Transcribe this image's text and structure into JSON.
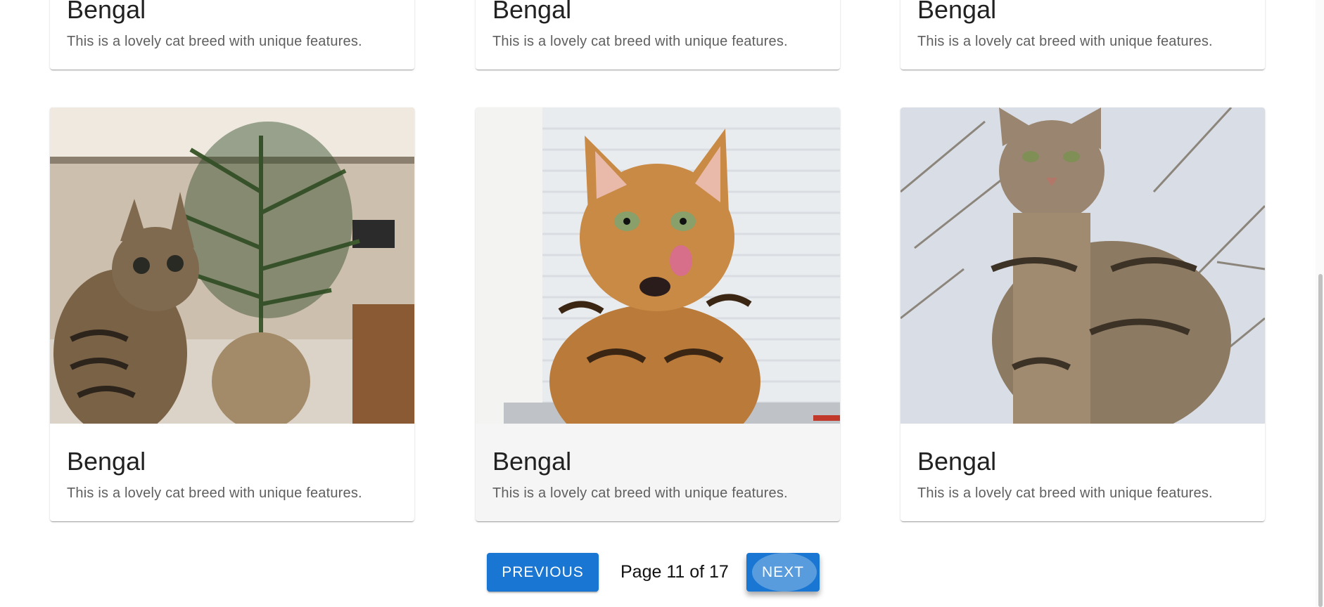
{
  "cards_top": [
    {
      "title": "Bengal",
      "description": "This is a lovely cat breed with unique features."
    },
    {
      "title": "Bengal",
      "description": "This is a lovely cat breed with unique features."
    },
    {
      "title": "Bengal",
      "description": "This is a lovely cat breed with unique features."
    }
  ],
  "cards_bottom": [
    {
      "title": "Bengal",
      "description": "This is a lovely cat breed with unique features.",
      "image": "cat-with-plant-photo"
    },
    {
      "title": "Bengal",
      "description": "This is a lovely cat breed with unique features.",
      "image": "cat-licking-photo"
    },
    {
      "title": "Bengal",
      "description": "This is a lovely cat breed with unique features.",
      "image": "cat-sitting-outdoors-photo"
    }
  ],
  "pagination": {
    "previous_label": "PREVIOUS",
    "page_text": "Page 11 of 17",
    "next_label": "NEXT"
  },
  "colors": {
    "primary": "#1976d2",
    "card_hover": "#f5f5f5"
  }
}
